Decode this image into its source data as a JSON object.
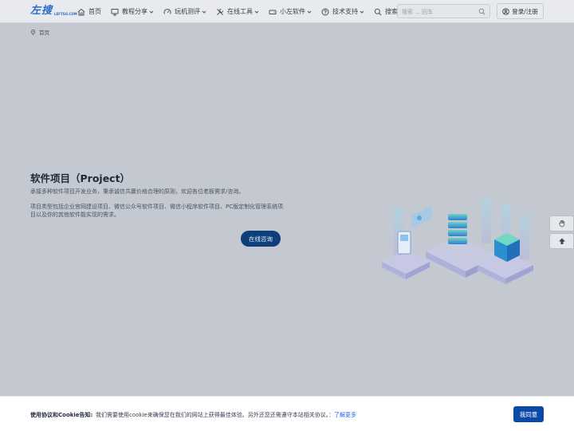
{
  "header": {
    "logo_text": "左搜",
    "logo_sub": "LEFTSO.COM",
    "nav": [
      {
        "label": "首页",
        "icon": "home-icon",
        "dropdown": false
      },
      {
        "label": "教程分享",
        "icon": "monitor-icon",
        "dropdown": true
      },
      {
        "label": "玩机测评",
        "icon": "gauge-icon",
        "dropdown": true
      },
      {
        "label": "在线工具",
        "icon": "tools-icon",
        "dropdown": true
      },
      {
        "label": "小左软件",
        "icon": "drive-icon",
        "dropdown": true
      },
      {
        "label": "技术支持",
        "icon": "help-icon",
        "dropdown": true
      },
      {
        "label": "搜索",
        "icon": "search-icon",
        "dropdown": false
      }
    ],
    "search_placeholder": "搜索 ... 回车",
    "login_label": "登录/注册"
  },
  "breadcrumb": {
    "home": "首页"
  },
  "hero": {
    "title": "软件项目（Project）",
    "desc1": "承接多种软件项目开发业务，秉承诚信共赢价格合理的原则，欢迎各位老板需求/咨询。",
    "desc2": "项目类型包括企业官网建设项目、微信公众号软件项目、微信小程序软件项目、PC版定制化管理系统项目以及你的其他软件能实现的需求。",
    "button": "在线咨询"
  },
  "side_buttons": [
    "hand-icon",
    "arrow-up-icon"
  ],
  "cookie": {
    "title": "使用协议和Cookie告知:",
    "text": "我们需要使用cookie来确保您在我们的网站上获得最佳体验。另外还您还需遵守本站相关协议。：",
    "link": "了解更多",
    "agree": "我同意"
  },
  "colors": {
    "accent": "#0b4aa8",
    "hero_button": "#0d3f7a",
    "logo": "#2a6cc8"
  }
}
